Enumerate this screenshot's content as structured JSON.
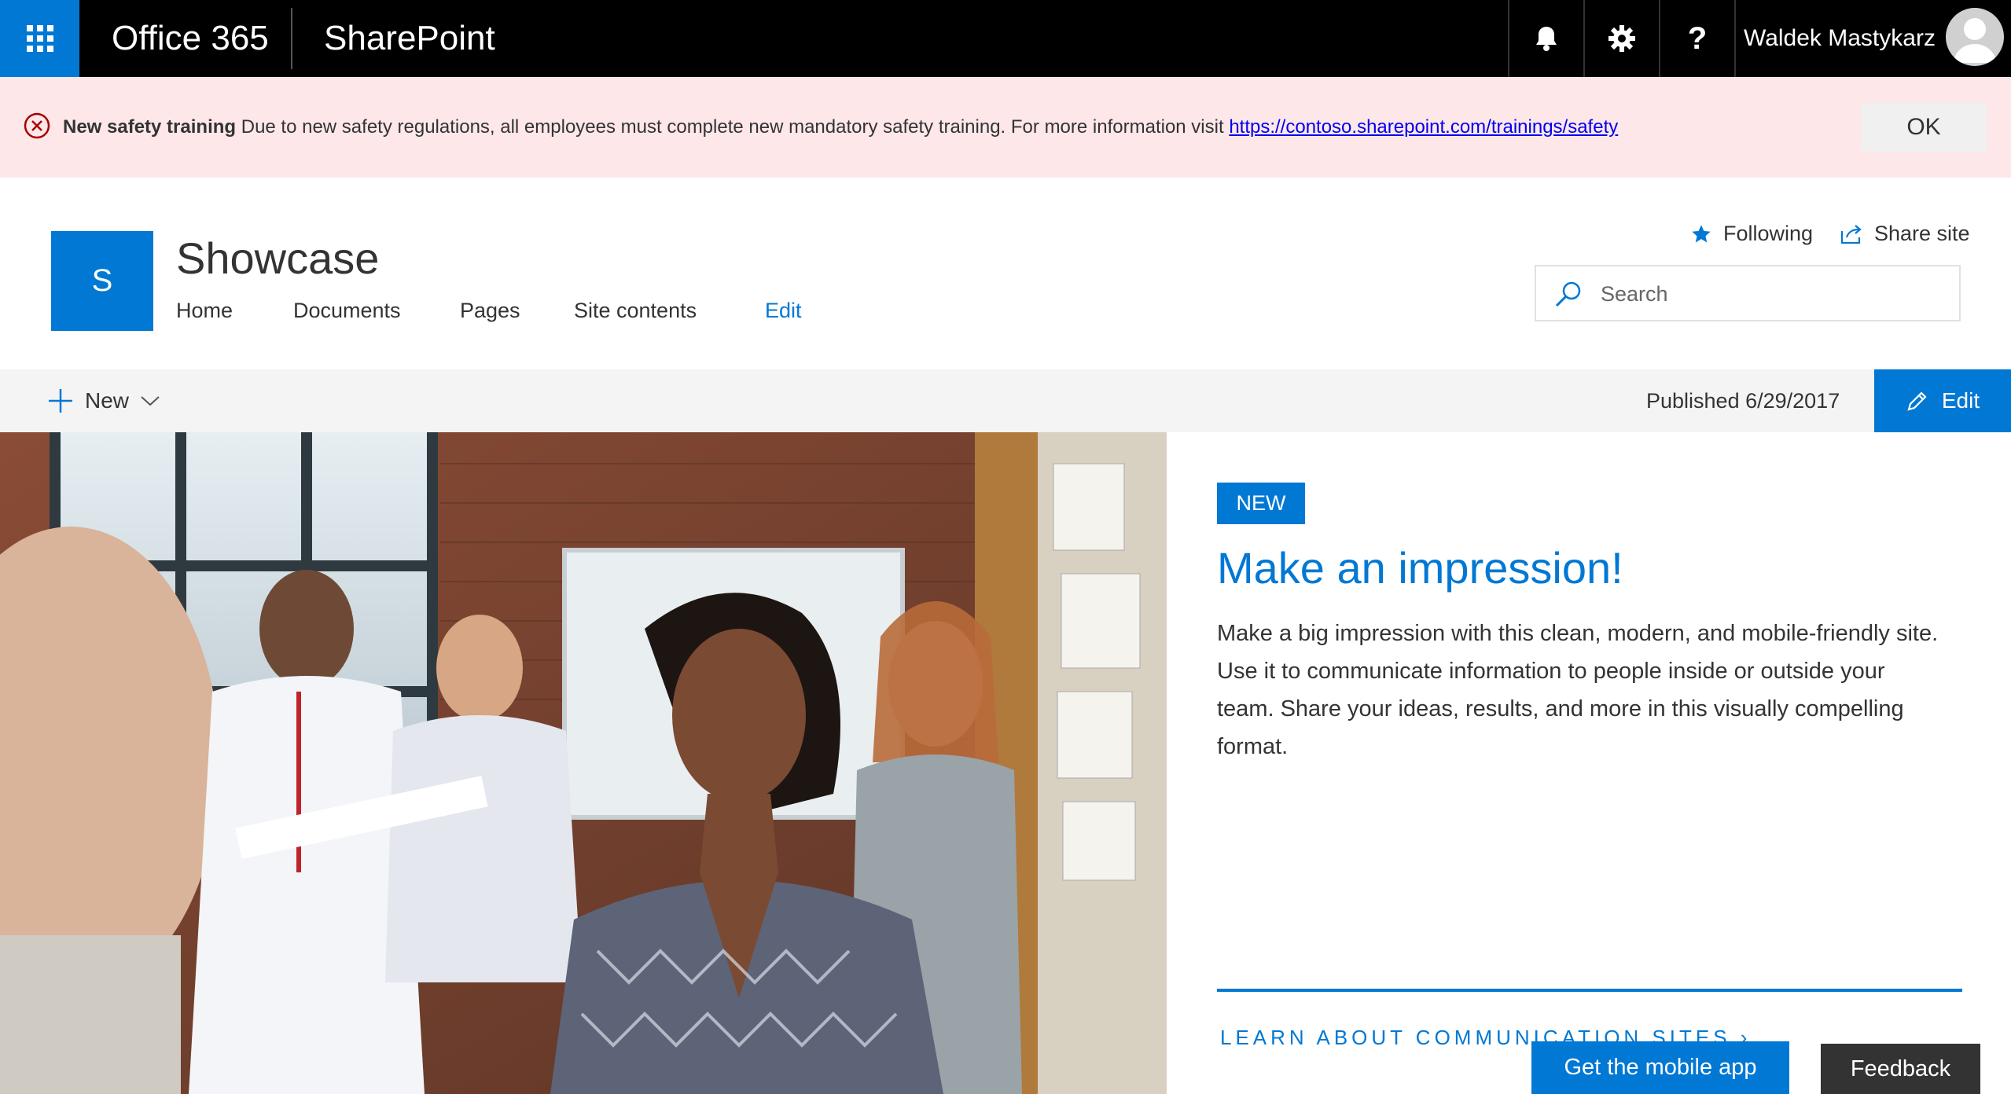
{
  "suite_bar": {
    "app_launcher_icon": "waffle-icon",
    "product": "Office 365",
    "app": "SharePoint",
    "notifications_icon": "bell-icon",
    "settings_icon": "gear-icon",
    "help_icon": "question-icon",
    "user_name": "Waldek Mastykarz",
    "avatar_icon": "person-icon"
  },
  "alert": {
    "icon": "error-circle-icon",
    "title": "New safety training",
    "message": "Due to new safety regulations, all employees must complete new mandatory safety training. For more information visit",
    "link": "https://contoso.sharepoint.com/trainings/safety",
    "ok_label": "OK"
  },
  "site": {
    "logo_letter": "S",
    "title": "Showcase",
    "nav": [
      "Home",
      "Documents",
      "Pages",
      "Site contents"
    ],
    "nav_edit": "Edit",
    "following_label": "Following",
    "share_label": "Share site",
    "search_placeholder": "Search"
  },
  "command_bar": {
    "new_label": "New",
    "published": "Published 6/29/2017",
    "edit_label": "Edit"
  },
  "hero": {
    "tag": "NEW",
    "title": "Make an impression!",
    "description": "Make a big impression with this clean, modern, and mobile-friendly site. Use it to communicate information to people inside or outside your team. Share your ideas, results, and more in this visually compelling format.",
    "link": "LEARN ABOUT COMMUNICATION SITES",
    "mobile_label": "Get the mobile app",
    "feedback_label": "Feedback"
  },
  "colors": {
    "accent": "#0078d4",
    "suite_bar": "#000000",
    "alert_bg": "#fde7e9",
    "alert_icon": "#a80000"
  }
}
